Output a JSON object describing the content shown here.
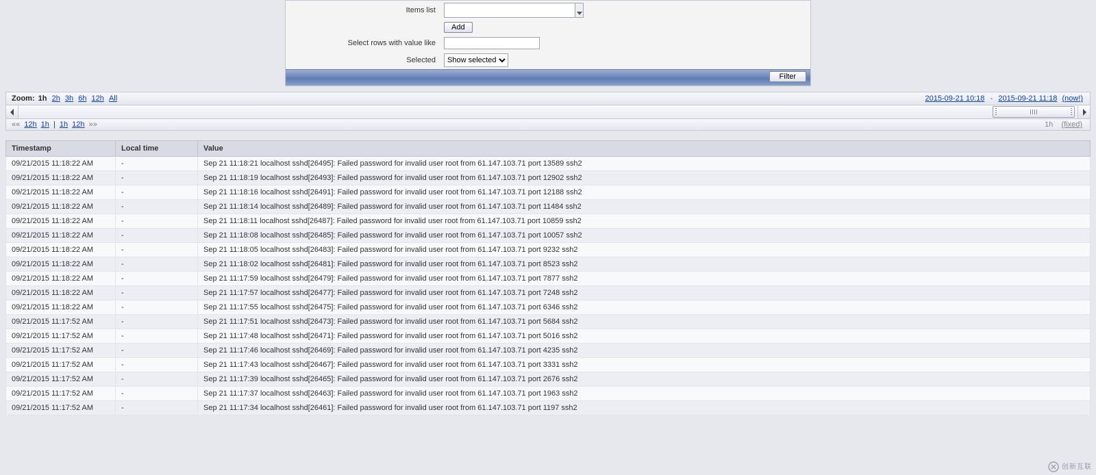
{
  "filter": {
    "items_list_label": "Items list",
    "add_label": "Add",
    "select_rows_label": "Select rows with value like",
    "select_rows_value": "",
    "selected_label": "Selected",
    "selected_option": "Show selected",
    "filter_button": "Filter"
  },
  "zoom": {
    "label": "Zoom:",
    "options": [
      "1h",
      "2h",
      "3h",
      "6h",
      "12h",
      "All"
    ],
    "active": "1h",
    "range_from": "2015-09-21 10:18",
    "range_sep": "-",
    "range_to": "2015-09-21 11:18",
    "range_now": "(now!)"
  },
  "nav": {
    "left_arrow": "««",
    "left_12h": "12h",
    "left_1h": "1h",
    "sep": "|",
    "right_1h": "1h",
    "right_12h": "12h",
    "right_arrow": "»»",
    "current": "1h",
    "fixed": "(fixed)"
  },
  "table": {
    "columns": [
      "Timestamp",
      "Local time",
      "Value"
    ],
    "rows": [
      {
        "ts": "09/21/2015 11:18:22 AM",
        "lt": "-",
        "val": "Sep 21 11:18:21 localhost sshd[26495]: Failed password for invalid user root from 61.147.103.71 port 13589 ssh2"
      },
      {
        "ts": "09/21/2015 11:18:22 AM",
        "lt": "-",
        "val": "Sep 21 11:18:19 localhost sshd[26493]: Failed password for invalid user root from 61.147.103.71 port 12902 ssh2"
      },
      {
        "ts": "09/21/2015 11:18:22 AM",
        "lt": "-",
        "val": "Sep 21 11:18:16 localhost sshd[26491]: Failed password for invalid user root from 61.147.103.71 port 12188 ssh2"
      },
      {
        "ts": "09/21/2015 11:18:22 AM",
        "lt": "-",
        "val": "Sep 21 11:18:14 localhost sshd[26489]: Failed password for invalid user root from 61.147.103.71 port 11484 ssh2"
      },
      {
        "ts": "09/21/2015 11:18:22 AM",
        "lt": "-",
        "val": "Sep 21 11:18:11 localhost sshd[26487]: Failed password for invalid user root from 61.147.103.71 port 10859 ssh2"
      },
      {
        "ts": "09/21/2015 11:18:22 AM",
        "lt": "-",
        "val": "Sep 21 11:18:08 localhost sshd[26485]: Failed password for invalid user root from 61.147.103.71 port 10057 ssh2"
      },
      {
        "ts": "09/21/2015 11:18:22 AM",
        "lt": "-",
        "val": "Sep 21 11:18:05 localhost sshd[26483]: Failed password for invalid user root from 61.147.103.71 port 9232 ssh2"
      },
      {
        "ts": "09/21/2015 11:18:22 AM",
        "lt": "-",
        "val": "Sep 21 11:18:02 localhost sshd[26481]: Failed password for invalid user root from 61.147.103.71 port 8523 ssh2"
      },
      {
        "ts": "09/21/2015 11:18:22 AM",
        "lt": "-",
        "val": "Sep 21 11:17:59 localhost sshd[26479]: Failed password for invalid user root from 61.147.103.71 port 7877 ssh2"
      },
      {
        "ts": "09/21/2015 11:18:22 AM",
        "lt": "-",
        "val": "Sep 21 11:17:57 localhost sshd[26477]: Failed password for invalid user root from 61.147.103.71 port 7248 ssh2"
      },
      {
        "ts": "09/21/2015 11:18:22 AM",
        "lt": "-",
        "val": "Sep 21 11:17:55 localhost sshd[26475]: Failed password for invalid user root from 61.147.103.71 port 6346 ssh2"
      },
      {
        "ts": "09/21/2015 11:17:52 AM",
        "lt": "-",
        "val": "Sep 21 11:17:51 localhost sshd[26473]: Failed password for invalid user root from 61.147.103.71 port 5684 ssh2"
      },
      {
        "ts": "09/21/2015 11:17:52 AM",
        "lt": "-",
        "val": "Sep 21 11:17:48 localhost sshd[26471]: Failed password for invalid user root from 61.147.103.71 port 5016 ssh2"
      },
      {
        "ts": "09/21/2015 11:17:52 AM",
        "lt": "-",
        "val": "Sep 21 11:17:46 localhost sshd[26469]: Failed password for invalid user root from 61.147.103.71 port 4235 ssh2"
      },
      {
        "ts": "09/21/2015 11:17:52 AM",
        "lt": "-",
        "val": "Sep 21 11:17:43 localhost sshd[26467]: Failed password for invalid user root from 61.147.103.71 port 3331 ssh2"
      },
      {
        "ts": "09/21/2015 11:17:52 AM",
        "lt": "-",
        "val": "Sep 21 11:17:39 localhost sshd[26465]: Failed password for invalid user root from 61.147.103.71 port 2676 ssh2"
      },
      {
        "ts": "09/21/2015 11:17:52 AM",
        "lt": "-",
        "val": "Sep 21 11:17:37 localhost sshd[26463]: Failed password for invalid user root from 61.147.103.71 port 1963 ssh2"
      },
      {
        "ts": "09/21/2015 11:17:52 AM",
        "lt": "-",
        "val": "Sep 21 11:17:34 localhost sshd[26461]: Failed password for invalid user root from 61.147.103.71 port 1197 ssh2"
      }
    ]
  },
  "watermark": "创新互联"
}
